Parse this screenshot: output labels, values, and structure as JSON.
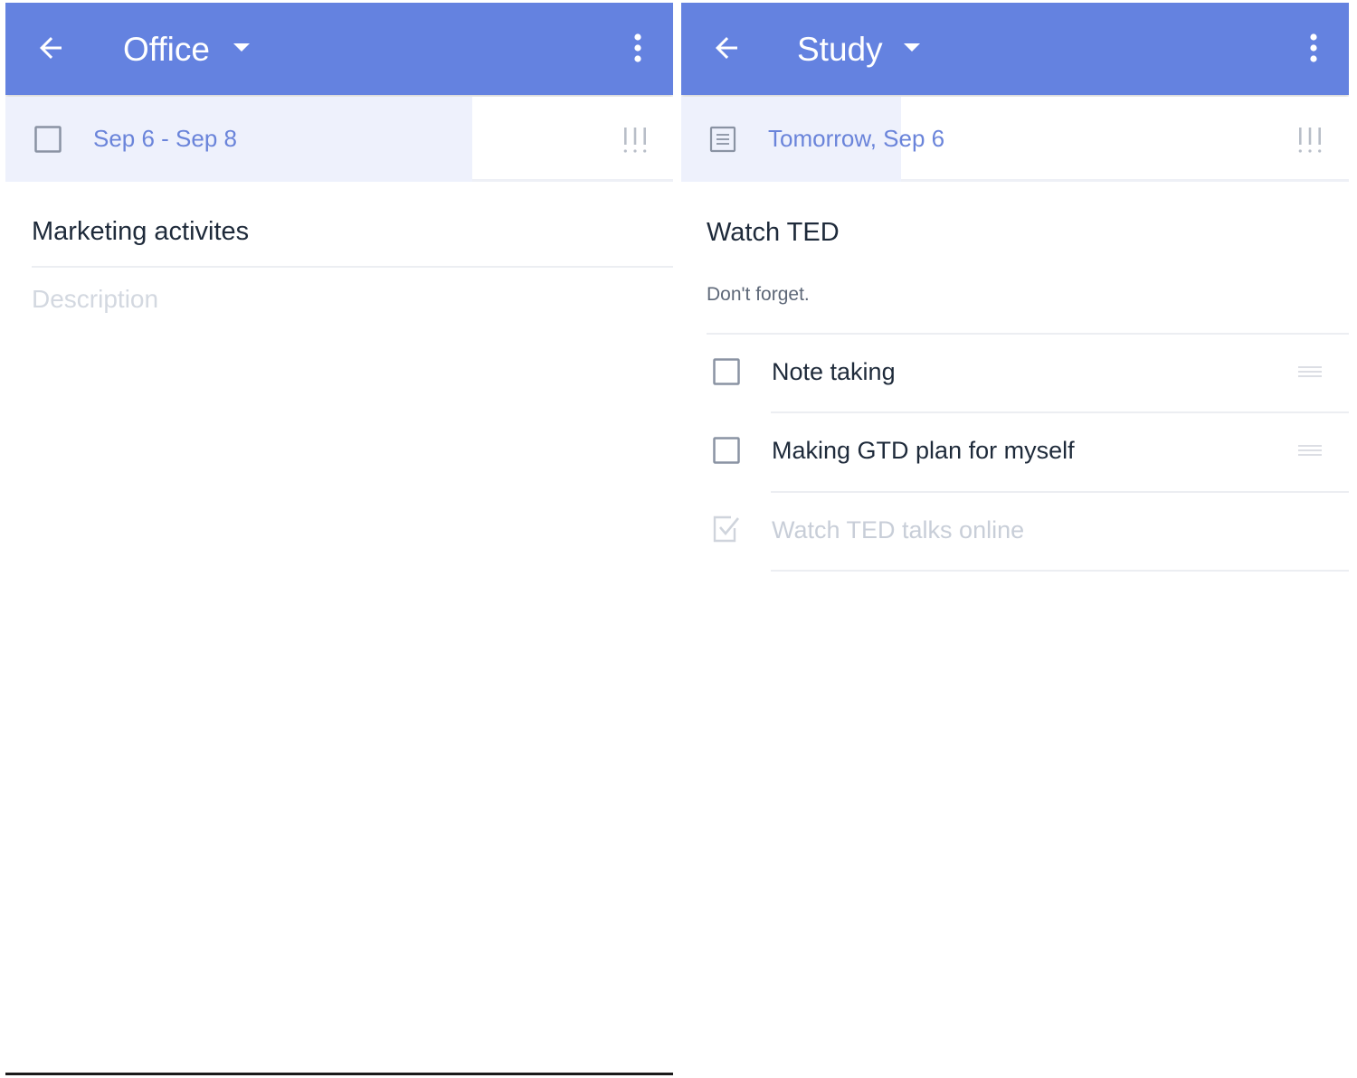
{
  "colors": {
    "appbar": "#6482e0",
    "accent_text": "#6a84da",
    "highlight": "#eef1fc",
    "title_text": "#1e2a3a",
    "muted": "#c8ced8"
  },
  "left": {
    "appbar": {
      "title": "Office",
      "back_icon": "arrow-back-icon",
      "dropdown_icon": "caret-down-icon",
      "menu_icon": "more-vert-icon"
    },
    "date": {
      "label": "Sep 6 - Sep 8",
      "lead_icon": "checkbox-icon",
      "priority_icon": "priority-icon",
      "priority_text": "!!!"
    },
    "task": {
      "title": "Marketing activites",
      "description_placeholder": "Description"
    }
  },
  "right": {
    "appbar": {
      "title": "Study",
      "back_icon": "arrow-back-icon",
      "dropdown_icon": "caret-down-icon",
      "menu_icon": "more-vert-icon"
    },
    "date": {
      "label": "Tomorrow, Sep 6",
      "lead_icon": "note-icon",
      "priority_icon": "priority-icon",
      "priority_text": "!!!"
    },
    "task": {
      "title": "Watch TED",
      "description": "Don't forget."
    },
    "subtasks": [
      {
        "label": "Note taking",
        "checked": false
      },
      {
        "label": "Making GTD plan for myself",
        "checked": false
      },
      {
        "label": "Watch TED talks online",
        "checked": true
      }
    ]
  }
}
